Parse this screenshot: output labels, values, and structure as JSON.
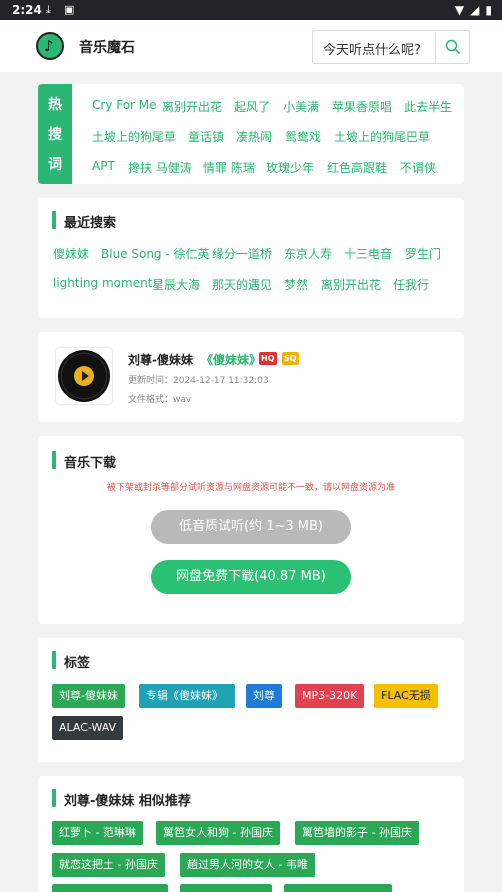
{
  "statusbar": {
    "time": "2:24",
    "icons": [
      "download-icon",
      "image-icon",
      "wifi-icon",
      "signal-icon",
      "battery-icon"
    ]
  },
  "header": {
    "app_title": "音乐魔石",
    "search_placeholder": "今天听点什么呢?",
    "logo_icon": "music-note-icon"
  },
  "hot": {
    "label": [
      "热",
      "搜",
      "词"
    ],
    "words": [
      "Cry For Me",
      "离别开出花",
      "起风了",
      "小美满",
      "苹果香原唱",
      "此去半生",
      "土坡上的狗尾草",
      "童话镇",
      "凑热闹",
      "鸳鸯戏",
      "土坡上的狗尾巴草",
      "APT",
      "搀扶 马健涛",
      "情罪 陈瑞",
      "玫瑰少年",
      "红色高跟鞋",
      "不谓侠"
    ]
  },
  "recent": {
    "title": "最近搜索",
    "words": [
      "傻妹妹",
      "Blue Song - 徐仁英",
      "缘分一道桥",
      "东京人寿",
      "十三电音",
      "罗生门",
      "lighting moment",
      "星辰大海",
      "那天的遇见",
      "梦然",
      "离别开出花",
      "任我行"
    ]
  },
  "song": {
    "title": "刘尊-傻妹妹",
    "album": "《傻妹妹》",
    "badges": [
      "HQ",
      "SQ"
    ],
    "update_time": "更新时间：2024-12-17 11:32:03",
    "format": "文件格式：wav"
  },
  "download": {
    "title": "音乐下载",
    "note": "被下架或封杀等部分试听资源与网盘资源可能不一致，请以网盘资源为准",
    "trial_button": "低音质试听(约 1~3 MB)",
    "download_button": "网盘免费下载(40.87 MB)"
  },
  "tags": {
    "title": "标签",
    "items": [
      "刘尊-傻妹妹",
      "专辑《傻妹妹》",
      "刘尊",
      "MP3-320K",
      "FLAC无损",
      "ALAC-WAV"
    ]
  },
  "recommend": {
    "title": "刘尊-傻妹妹 相似推荐",
    "items": [
      "红萝卜 - 范琳琳",
      "篱笆女人和狗 - 孙国庆",
      "篱笆墙的影子 - 孙国庆",
      "就恋这把土 - 孙国庆",
      "趟过男人河的女人 - 韦唯"
    ]
  },
  "colors": {
    "accent": "#2bb673",
    "tag_green": "#2aa856",
    "tag_teal": "#1fa2b5",
    "tag_blue": "#1e7bd6",
    "tag_red": "#e0434f",
    "tag_yellow": "#f5c000",
    "tag_dark": "#353a3f",
    "hq": "#e03030",
    "sq": "#f0b400"
  }
}
